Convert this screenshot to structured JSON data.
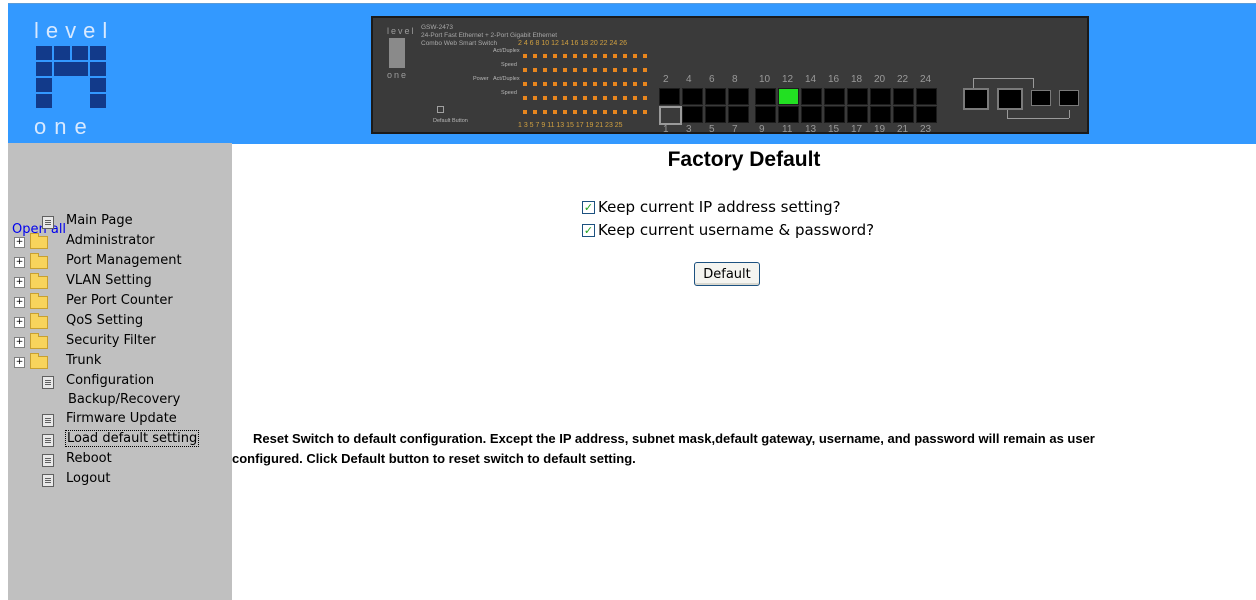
{
  "colors": {
    "header_bg": "#3399ff",
    "sidebar_bg": "#c0c0c0",
    "link": "#0000ee",
    "active_port": "#22e022",
    "led": "#e8861e"
  },
  "header": {
    "logo": {
      "top": "level",
      "bottom": "one"
    },
    "panel": {
      "brand_top": "level",
      "brand_bottom": "one",
      "model": "GSW-2473",
      "desc1": "24-Port Fast Ethernet + 2-Port Gigabit Ethernet",
      "desc2": "Combo Web Smart Switch",
      "led_top_nums": "2 4 6 8 10 12 14 16 18 20 22 24 26",
      "led_bot_nums": "1 3 5 7 9 11 13 15 17 19 21 23 25",
      "act_duplex": "Act/Duplex",
      "speed": "Speed",
      "power": "Power",
      "default_button": "Default Button",
      "port_top": [
        "2",
        "4",
        "6",
        "8",
        "10",
        "12",
        "14",
        "16",
        "18",
        "20",
        "22",
        "24"
      ],
      "port_bot": [
        "1",
        "3",
        "5",
        "7",
        "9",
        "11",
        "13",
        "15",
        "17",
        "19",
        "21",
        "23"
      ],
      "active_port": "12"
    }
  },
  "sidebar": {
    "open_all": "Open all",
    "items": [
      {
        "label": "Main Page",
        "type": "page"
      },
      {
        "label": "Administrator",
        "type": "folder"
      },
      {
        "label": "Port Management",
        "type": "folder"
      },
      {
        "label": "VLAN Setting",
        "type": "folder"
      },
      {
        "label": "Per Port Counter",
        "type": "folder"
      },
      {
        "label": "QoS Setting",
        "type": "folder"
      },
      {
        "label": "Security Filter",
        "type": "folder"
      },
      {
        "label": "Trunk",
        "type": "folder"
      },
      {
        "label": "Configuration",
        "label2": "Backup/Recovery",
        "type": "page"
      },
      {
        "label": "Firmware Update",
        "type": "page"
      },
      {
        "label": "Load default setting",
        "type": "page",
        "selected": true
      },
      {
        "label": "Reboot",
        "type": "page"
      },
      {
        "label": "Logout",
        "type": "page"
      }
    ]
  },
  "main": {
    "title": "Factory Default",
    "options": [
      {
        "label": "Keep current IP address setting?",
        "checked": true
      },
      {
        "label": "Keep current username & password?",
        "checked": true
      }
    ],
    "button_label": "Default",
    "description_line1": "Reset Switch to default configuration. Except the IP address, subnet mask,default gateway, username, and password will remain as user",
    "description_line2": "configured. Click Default button to reset switch to default setting."
  }
}
